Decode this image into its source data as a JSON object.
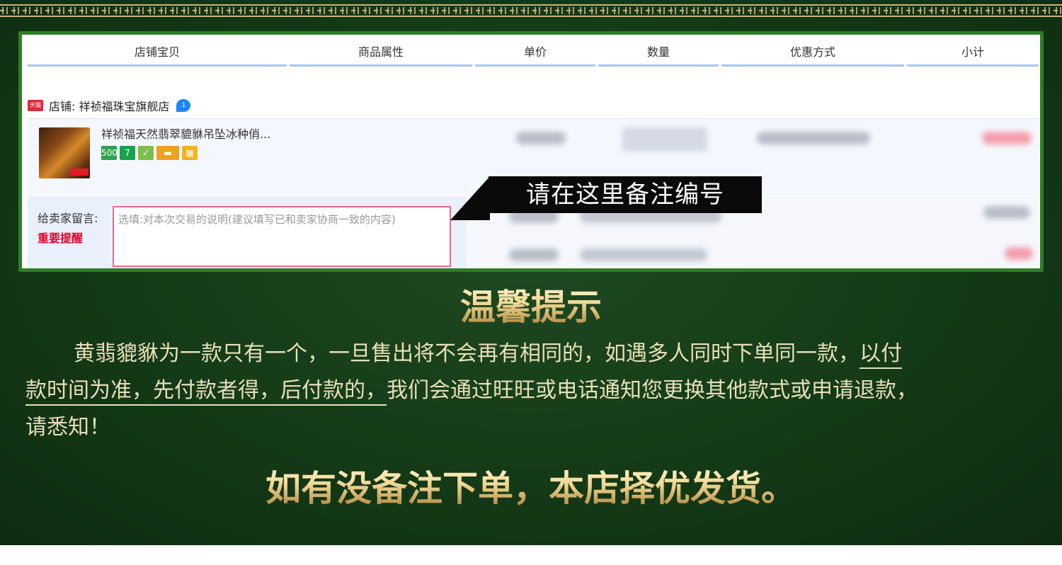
{
  "table": {
    "headers": [
      "店铺宝贝",
      "商品属性",
      "单价",
      "数量",
      "优惠方式",
      "小计"
    ]
  },
  "store": {
    "badge": "天猫",
    "name": "店铺: 祥祯福珠宝旗舰店",
    "wangwang_badge": "1"
  },
  "item": {
    "title": "祥祯福天然翡翠貔貅吊坠冰种俏...",
    "badges": [
      {
        "icon": "cat-icon",
        "text": "500",
        "color": "#2ba34a"
      },
      {
        "icon": "seven-days-icon",
        "text": "7",
        "color": "#16a34a"
      },
      {
        "icon": "shield-icon",
        "text": "✓",
        "color": "#7cc04b"
      },
      {
        "icon": "card-icon",
        "text": "▬",
        "color": "#f0a020"
      },
      {
        "icon": "grid-icon",
        "text": "▦",
        "color": "#f5b21a"
      }
    ]
  },
  "message": {
    "label": "给卖家留言:",
    "warning": "重要提醒",
    "placeholder": "选填:对本次交易的说明(建议填写已和卖家协商一致的内容)"
  },
  "callout": {
    "text": "请在这里备注编号"
  },
  "notice": {
    "title": "温馨提示",
    "line1_a": "黄翡貔貅为一款只有一个，一旦售出将不会再有相同的，如遇多人同时下单同一款，",
    "line1_b": "以付",
    "line2_a": "款时间为准，先付款者得，后付款的，",
    "line2_b": "我们会通过旺旺或电话通知您更换其他款式或申请退款，",
    "line3": "请悉知！",
    "final": "如有没备注下单，本店择优发货。"
  }
}
